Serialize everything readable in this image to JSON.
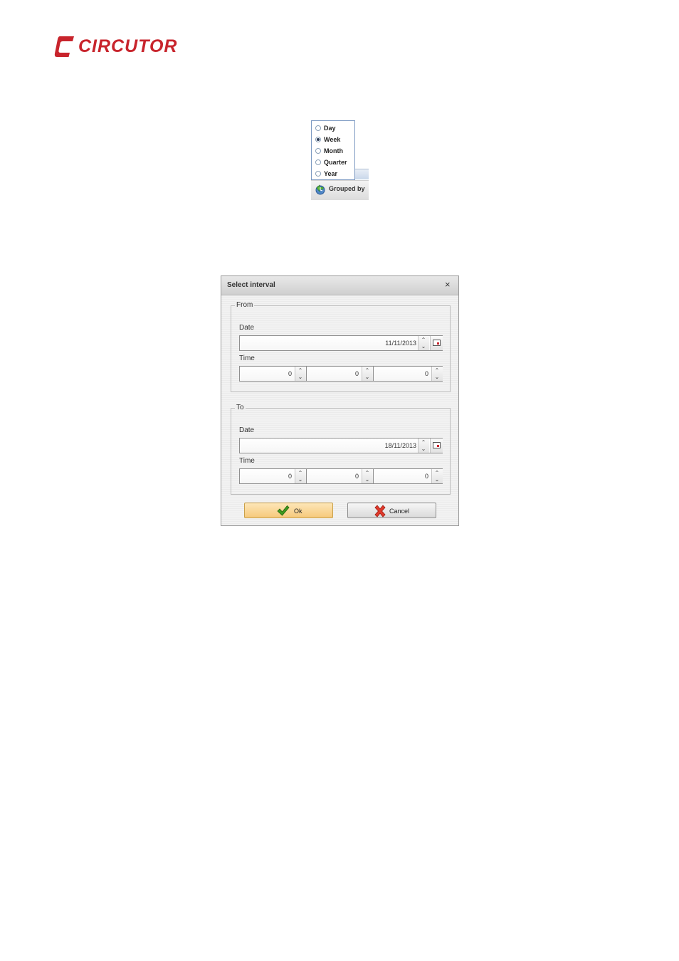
{
  "logo": {
    "text": "CIRCUTOR",
    "color": "#c8242c"
  },
  "grouped_by": {
    "label": "Grouped by",
    "icon": "grouping-icon",
    "options": [
      {
        "label": "Day",
        "selected": false
      },
      {
        "label": "Week",
        "selected": true
      },
      {
        "label": "Month",
        "selected": false
      },
      {
        "label": "Quarter",
        "selected": false
      },
      {
        "label": "Year",
        "selected": false
      }
    ]
  },
  "dialog": {
    "title": "Select interval",
    "close_glyph": "×",
    "from": {
      "legend": "From",
      "date_label": "Date",
      "date_value": "11/11/2013",
      "time_label": "Time",
      "time_values": [
        "0",
        "0",
        "0"
      ]
    },
    "to": {
      "legend": "To",
      "date_label": "Date",
      "date_value": "18/11/2013",
      "time_label": "Time",
      "time_values": [
        "0",
        "0",
        "0"
      ]
    },
    "ok_label": "Ok",
    "cancel_label": "Cancel",
    "accent_ok": "#f6c97c"
  }
}
